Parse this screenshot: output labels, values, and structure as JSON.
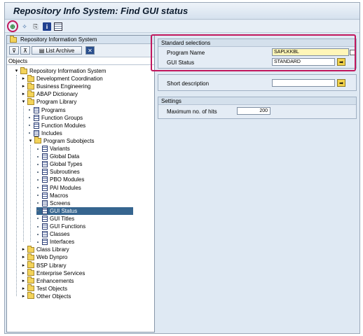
{
  "window": {
    "title": "Repository Info System: Find GUI status"
  },
  "toolbar": {
    "icons": [
      "execute-icon",
      "other-object-icon",
      "find-icon",
      "information-icon",
      "table-icon"
    ]
  },
  "left": {
    "header": "Repository Information System",
    "list_archive_label": "List Archive",
    "column_header": "Objects",
    "tree": [
      {
        "label": "Repository Information System",
        "level": 0,
        "expanded": true,
        "icon": "folder"
      },
      {
        "label": "Development Coordination",
        "level": 1,
        "expanded": false,
        "icon": "folder"
      },
      {
        "label": "Business Engineering",
        "level": 1,
        "expanded": false,
        "icon": "folder"
      },
      {
        "label": "ABAP Dictionary",
        "level": 1,
        "expanded": false,
        "icon": "folder"
      },
      {
        "label": "Program Library",
        "level": 1,
        "expanded": true,
        "icon": "folder"
      },
      {
        "label": "Programs",
        "level": 2,
        "icon": "doc"
      },
      {
        "label": "Function Groups",
        "level": 2,
        "icon": "doc"
      },
      {
        "label": "Function Modules",
        "level": 2,
        "icon": "doc"
      },
      {
        "label": "Includes",
        "level": 2,
        "icon": "doc"
      },
      {
        "label": "Program Subobjects",
        "level": 2,
        "expanded": true,
        "icon": "folder"
      },
      {
        "label": "Variants",
        "level": 3,
        "icon": "doc"
      },
      {
        "label": "Global Data",
        "level": 3,
        "icon": "doc"
      },
      {
        "label": "Global Types",
        "level": 3,
        "icon": "doc"
      },
      {
        "label": "Subroutines",
        "level": 3,
        "icon": "doc"
      },
      {
        "label": "PBO Modules",
        "level": 3,
        "icon": "doc"
      },
      {
        "label": "PAI Modules",
        "level": 3,
        "icon": "doc"
      },
      {
        "label": "Macros",
        "level": 3,
        "icon": "doc"
      },
      {
        "label": "Screens",
        "level": 3,
        "icon": "doc"
      },
      {
        "label": "GUI Status",
        "level": 3,
        "icon": "doc",
        "selected": true
      },
      {
        "label": "GUI Titles",
        "level": 3,
        "icon": "doc"
      },
      {
        "label": "GUI Functions",
        "level": 3,
        "icon": "doc"
      },
      {
        "label": "Classes",
        "level": 3,
        "icon": "doc"
      },
      {
        "label": "Interfaces",
        "level": 3,
        "icon": "doc"
      },
      {
        "label": "Class Library",
        "level": 1,
        "expanded": false,
        "icon": "folder"
      },
      {
        "label": "Web Dynpro",
        "level": 1,
        "expanded": false,
        "icon": "folder"
      },
      {
        "label": "BSP Library",
        "level": 1,
        "expanded": false,
        "icon": "folder"
      },
      {
        "label": "Enterprise Services",
        "level": 1,
        "expanded": false,
        "icon": "folder"
      },
      {
        "label": "Enhancements",
        "level": 1,
        "expanded": false,
        "icon": "folder"
      },
      {
        "label": "Test Objects",
        "level": 1,
        "expanded": false,
        "icon": "folder"
      },
      {
        "label": "Other Objects",
        "level": 1,
        "expanded": false,
        "icon": "folder"
      }
    ]
  },
  "right": {
    "standard_selections": {
      "title": "Standard selections",
      "program_name_label": "Program Name",
      "program_name_value": "SAPLKKBL",
      "gui_status_label": "GUI Status",
      "gui_status_value": "STANDARD"
    },
    "short_description_label": "Short description",
    "settings": {
      "title": "Settings",
      "max_hits_label": "Maximum no. of hits",
      "max_hits_value": "200"
    }
  },
  "colors": {
    "highlight": "#c1175d",
    "selection": "#36658f"
  }
}
